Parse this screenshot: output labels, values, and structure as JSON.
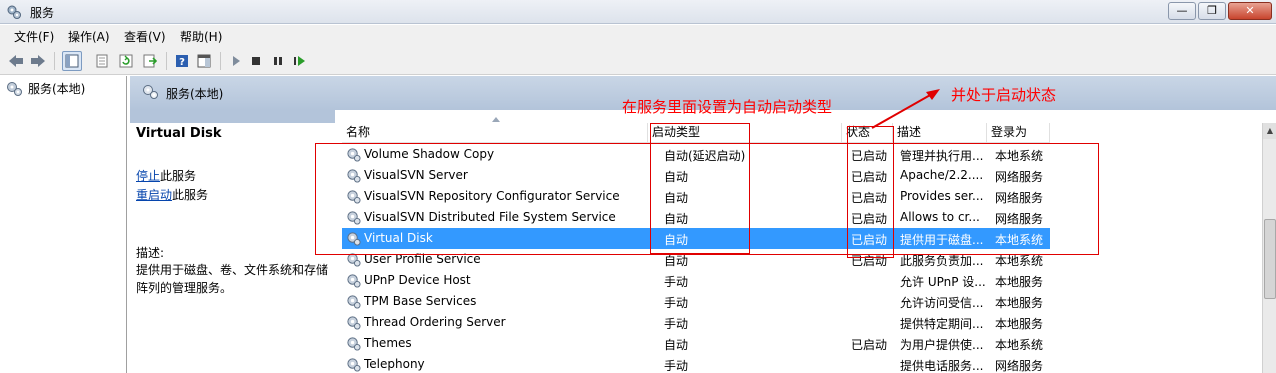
{
  "window": {
    "title": "服务",
    "buttons": {
      "minimize": "—",
      "maximize": "❐",
      "close": "✕"
    }
  },
  "menu": [
    "文件(F)",
    "操作(A)",
    "查看(V)",
    "帮助(H)"
  ],
  "toolbar": [
    "back-icon",
    "forward-icon",
    "show-hide-console-tree-icon",
    "properties-icon",
    "refresh-icon",
    "export-list-icon",
    "help-icon",
    "show-hide-action-pane-icon",
    "start-service-icon",
    "stop-service-icon",
    "pause-service-icon",
    "restart-service-icon"
  ],
  "tree": {
    "root_label": "服务(本地)"
  },
  "header": {
    "title": "服务(本地)"
  },
  "details": {
    "service_name": "Virtual Disk",
    "stop_link": "停止",
    "stop_suffix": "此服务",
    "restart_link": "重启动",
    "restart_suffix": "此服务",
    "description_label": "描述:",
    "description_text": "提供用于磁盘、卷、文件系统和存储阵列的管理服务。"
  },
  "columns": [
    "名称",
    "启动类型",
    "状态",
    "描述",
    "登录为"
  ],
  "services": [
    {
      "name": "Volume Shadow Copy",
      "startup": "自动(延迟启动)",
      "status": "已启动",
      "desc": "管理并执行用...",
      "logon": "本地系统"
    },
    {
      "name": "VisualSVN Server",
      "startup": "自动",
      "status": "已启动",
      "desc": "Apache/2.2....",
      "logon": "网络服务"
    },
    {
      "name": "VisualSVN Repository Configurator Service",
      "startup": "自动",
      "status": "已启动",
      "desc": "Provides ser...",
      "logon": "网络服务"
    },
    {
      "name": "VisualSVN Distributed File System Service",
      "startup": "自动",
      "status": "已启动",
      "desc": "Allows to cr...",
      "logon": "网络服务"
    },
    {
      "name": "Virtual Disk",
      "startup": "自动",
      "status": "已启动",
      "desc": "提供用于磁盘...",
      "logon": "本地系统",
      "selected": true
    },
    {
      "name": "User Profile Service",
      "startup": "自动",
      "status": "已启动",
      "desc": "此服务负责加...",
      "logon": "本地系统"
    },
    {
      "name": "UPnP Device Host",
      "startup": "手动",
      "status": "",
      "desc": "允许 UPnP 设...",
      "logon": "本地服务"
    },
    {
      "name": "TPM Base Services",
      "startup": "手动",
      "status": "",
      "desc": "允许访问受信...",
      "logon": "本地服务"
    },
    {
      "name": "Thread Ordering Server",
      "startup": "手动",
      "status": "",
      "desc": "提供特定期间...",
      "logon": "本地服务"
    },
    {
      "name": "Themes",
      "startup": "自动",
      "status": "已启动",
      "desc": "为用户提供使...",
      "logon": "本地系统"
    },
    {
      "name": "Telephony",
      "startup": "手动",
      "status": "",
      "desc": "提供电话服务...",
      "logon": "网络服务"
    }
  ],
  "annotations": {
    "note1": "在服务里面设置为自动启动类型",
    "note2": "并处于启动状态",
    "color": "#ff0000"
  },
  "colors": {
    "selection": "#3399ff",
    "header_band": "#b3c4da",
    "link": "#0645ad"
  }
}
